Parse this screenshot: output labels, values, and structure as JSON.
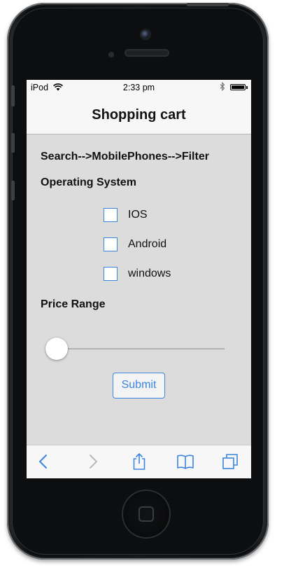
{
  "device": {
    "model": "iPod"
  },
  "status_bar": {
    "carrier": "iPod",
    "time": "2:33 pm"
  },
  "nav_bar": {
    "title": "Shopping cart"
  },
  "filter": {
    "breadcrumb": "Search-->MobilePhones-->Filter",
    "os_heading": "Operating System",
    "options": [
      {
        "label": "IOS",
        "checked": false
      },
      {
        "label": "Android",
        "checked": false
      },
      {
        "label": "windows",
        "checked": false
      }
    ],
    "price_heading": "Price Range",
    "price_slider_value": 0,
    "submit_label": "Submit"
  },
  "toolbar": {
    "icons": [
      "back-icon",
      "forward-icon",
      "share-icon",
      "bookmarks-icon",
      "tabs-icon"
    ]
  },
  "colors": {
    "accent": "#3a86e0",
    "screen_bg": "#dcdcdc",
    "bar_bg": "#f7f7f7"
  }
}
